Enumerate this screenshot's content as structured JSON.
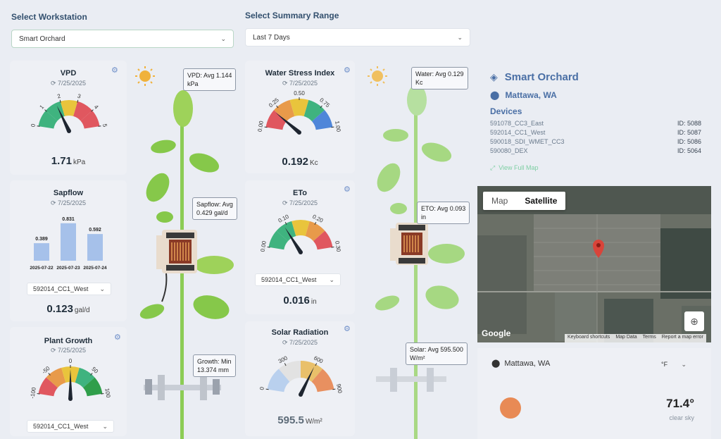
{
  "workstation": {
    "label": "Select Workstation",
    "selected": "Smart Orchard"
  },
  "range": {
    "label": "Select Summary Range",
    "selected": "Last 7 Days"
  },
  "vpd": {
    "title": "VPD",
    "date": "7/25/2025",
    "value": "1.71",
    "unit": "kPa",
    "ticks": [
      "0",
      "1",
      "2",
      "3",
      "4",
      "5"
    ],
    "needle_fraction": 0.342,
    "tooltip_line1": "VPD: Avg 1.144",
    "tooltip_line2": "kPa"
  },
  "sapflow": {
    "title": "Sapflow",
    "date": "7/25/2025",
    "device": "592014_CC1_West",
    "value": "0.123",
    "unit": "gal/d",
    "tooltip_line1": "Sapflow: Avg",
    "tooltip_line2": "0.429 gal/d",
    "bars": [
      {
        "date": "2025-07-22",
        "value": 0.389,
        "label": "0.389"
      },
      {
        "date": "2025-07-23",
        "value": 0.831,
        "label": "0.831"
      },
      {
        "date": "2025-07-24",
        "value": 0.592,
        "label": "0.592"
      }
    ]
  },
  "growth": {
    "title": "Plant Growth",
    "date": "7/25/2025",
    "device": "592014_CC1_West",
    "ticks": [
      "-100",
      "-50",
      "0",
      "50",
      "100"
    ],
    "needle_fraction": 0.5,
    "tooltip_line1": "Growth: Min",
    "tooltip_line2": "13.374 mm"
  },
  "wsi": {
    "title": "Water Stress Index",
    "date": "7/25/2025",
    "value": "0.192",
    "unit": "Kc",
    "ticks": [
      "0.00",
      "0.25",
      "0.50",
      "0.75",
      "1.00"
    ],
    "needle_fraction": 0.192,
    "tooltip_line1": "Water: Avg 0.129",
    "tooltip_line2": "Kc"
  },
  "eto": {
    "title": "ETo",
    "date": "7/25/2025",
    "device": "592014_CC1_West",
    "value": "0.016",
    "unit": "in",
    "ticks": [
      "0.00",
      "0.10",
      "0.20",
      "0.30"
    ],
    "needle_fraction": 0.3,
    "tooltip_line1": "ETO: Avg 0.093",
    "tooltip_line2": "in"
  },
  "solar": {
    "title": "Solar Radiation",
    "date": "7/25/2025",
    "value": "595.5",
    "unit": "W/m²",
    "ticks": [
      "0",
      "300",
      "600",
      "900"
    ],
    "needle_fraction": 0.66,
    "tooltip_line1": "Solar: Avg 595.500",
    "tooltip_line2": "W/m²"
  },
  "station": {
    "name": "Smart Orchard",
    "location": "Mattawa, WA",
    "devices_label": "Devices",
    "devices": [
      {
        "name": "591078_CC3_East",
        "id": "ID: 5088"
      },
      {
        "name": "592014_CC1_West",
        "id": "ID: 5087"
      },
      {
        "name": "590018_SDI_WMET_CC3",
        "id": "ID: 5086"
      },
      {
        "name": "590080_DEX",
        "id": "ID: 5064"
      }
    ],
    "map_link": "View Full Map"
  },
  "map": {
    "tab_map": "Map",
    "tab_satellite": "Satellite",
    "google": "Google",
    "footer": [
      "Keyboard shortcuts",
      "Map Data",
      "Terms",
      "Report a map error"
    ]
  },
  "weather": {
    "location": "Mattawa, WA",
    "unit": "°F",
    "temp": "71.4°",
    "condition": "clear sky"
  },
  "colors": {
    "accent": "#4a6fa5",
    "green": "#3fb37f",
    "yellow": "#e9c43c",
    "red": "#e0575f",
    "blue": "#4f86d9"
  }
}
